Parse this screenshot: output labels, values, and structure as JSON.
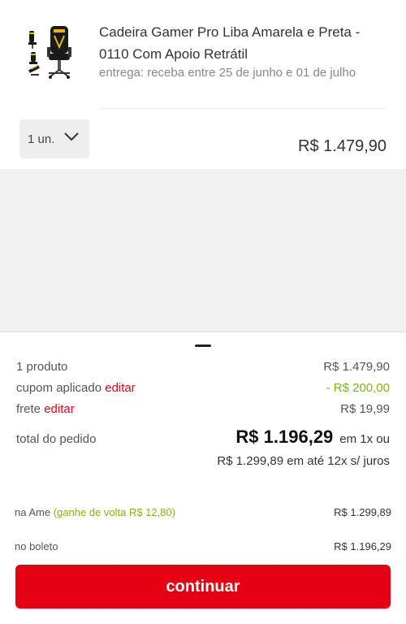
{
  "product": {
    "title": "Cadeira Gamer Pro Liba Amarela e Preta - 0110 Com Apoio Retrátil",
    "delivery": "entrega: receba entre 25 de junho e 01 de julho",
    "quantity": "1 un.",
    "price": "R$ 1.479,90",
    "thumb_icon": "gaming-chair-image",
    "colors": {
      "seat": "#1a1a1a",
      "accent": "#e6b800"
    }
  },
  "summary": {
    "products_label": "1 produto",
    "products_value": "R$ 1.479,90",
    "coupon_label": "cupom aplicado",
    "coupon_edit": "editar",
    "coupon_value": "- R$ 200,00",
    "shipping_label": "frete",
    "shipping_edit": "editar",
    "shipping_value": "R$ 19,99",
    "total_label": "total do pedido",
    "total_value": "R$ 1.196,29",
    "total_suffix": "em 1x ou",
    "installments": "R$ 1.299,89 em até 12x s/ juros"
  },
  "payment": {
    "ame_label": "na Ame",
    "ame_cashback": "(ganhe de volta R$ 12,80)",
    "ame_value": "R$ 1.299,89",
    "boleto_label": "no boleto",
    "boleto_value": "R$ 1.196,29"
  },
  "continue_label": "continuar",
  "theme": {
    "primary": "#e60014",
    "success": "#7cb518"
  }
}
